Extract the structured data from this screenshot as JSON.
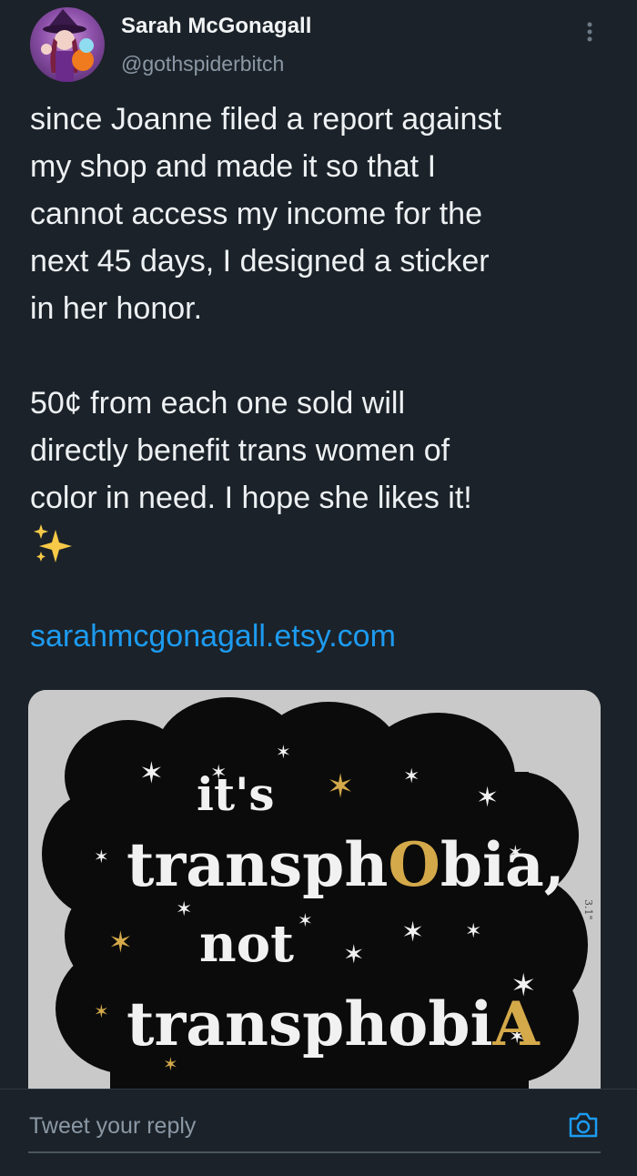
{
  "tweet": {
    "author_name": "Sarah McGonagall",
    "author_handle": "@gothspiderbitch",
    "text": "since Joanne filed a report against\nmy shop and made it so that I\ncannot access my income for the\nnext 45 days, I designed a sticker\nin her honor.\n\n50¢ from each one sold will\ndirectly benefit trans women of\ncolor in need. I hope she likes it!",
    "sparkle_emoji": "sparkles-icon",
    "link": "sarahmcgonagall.etsy.com"
  },
  "sticker": {
    "line1": "it's",
    "line2_pre": "transph",
    "line2_gold": "O",
    "line2_post": "bia,",
    "line3": "not",
    "line4_pre": "transphobi",
    "line4_gold": "A",
    "size_label": "3.1\""
  },
  "reply": {
    "placeholder": "Tweet your reply"
  },
  "colors": {
    "background": "#1b2229",
    "link": "#1d9bf0",
    "gold": "#d4a94a",
    "secondary_text": "#8b98a5"
  }
}
